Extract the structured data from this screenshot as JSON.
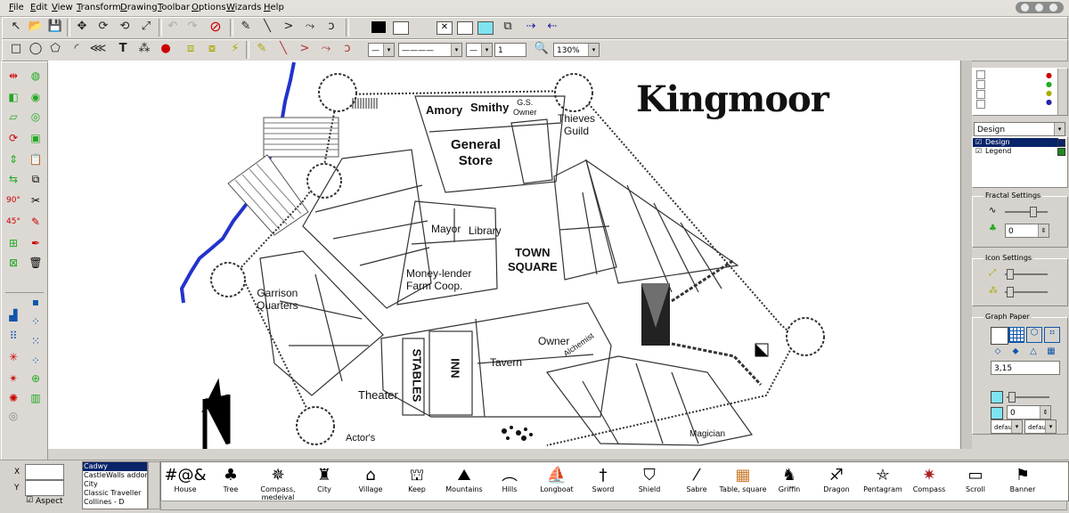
{
  "menu": [
    "File",
    "Edit",
    "View",
    "Transform",
    "Drawing",
    "Toolbar",
    "Options",
    "Wizards",
    "Help"
  ],
  "line_style": {
    "width_value": "1",
    "zoom": "130%"
  },
  "map": {
    "title": "Kingmoor",
    "labels": {
      "amory": "Amory",
      "smithy": "Smithy",
      "gs_owner": "G.S.\nOwner",
      "thieves_guild": "Thieves\nGuild",
      "general_store": "General\nStore",
      "mayor": "Mayor",
      "library": "Library",
      "town_square": "TOWN\nSQUARE",
      "money_lender": "Money-lender\nFarm Coop.",
      "garrison": "Garrison\nQuarters",
      "stables": "STABLES",
      "inn": "INN",
      "tavern": "Tavern",
      "owner": "Owner",
      "alchemist": "Alchemist",
      "theater": "Theater",
      "actors": "Actor's",
      "magician": "Magician"
    }
  },
  "layers": {
    "dropdown": "Design",
    "items": [
      {
        "name": "Design",
        "color": "#0a246a",
        "selected": true
      },
      {
        "name": "Legend",
        "color": "#1f8a1f",
        "selected": false
      }
    ]
  },
  "fractal": {
    "title": "Fractal Settings",
    "value": "0"
  },
  "icon_settings": {
    "title": "Icon Settings"
  },
  "graph_paper": {
    "title": "Graph Paper",
    "value": "3,15",
    "value2": "0",
    "combo1": "defau",
    "combo2": "defau"
  },
  "coords": {
    "x_label": "X",
    "y_label": "Y",
    "aspect_label": "Aspect"
  },
  "styles": [
    "Cadwy",
    "CastleWalls addon",
    "City",
    "Classic Traveller",
    "Collines - D",
    "..."
  ],
  "symbols": [
    {
      "name": "House",
      "glyph": "#@&"
    },
    {
      "name": "Tree",
      "glyph": "♣"
    },
    {
      "name": "Compass, medeival",
      "glyph": "✵"
    },
    {
      "name": "City",
      "glyph": "♜"
    },
    {
      "name": "Village",
      "glyph": "⌂"
    },
    {
      "name": "Keep",
      "glyph": "⛫"
    },
    {
      "name": "Mountains",
      "glyph": "⛰"
    },
    {
      "name": "Hills",
      "glyph": "︵"
    },
    {
      "name": "Longboat",
      "glyph": "⛵"
    },
    {
      "name": "Sword",
      "glyph": "†"
    },
    {
      "name": "Shield",
      "glyph": "⛉"
    },
    {
      "name": "Sabre",
      "glyph": "⁄"
    },
    {
      "name": "Table, square",
      "glyph": "▦"
    },
    {
      "name": "Griffin",
      "glyph": "♞"
    },
    {
      "name": "Dragon",
      "glyph": "♐"
    },
    {
      "name": "Pentagram",
      "glyph": "⛤"
    },
    {
      "name": "Compass",
      "glyph": "✷"
    },
    {
      "name": "Scroll",
      "glyph": "▭"
    },
    {
      "name": "Banner",
      "glyph": "⚑"
    }
  ]
}
